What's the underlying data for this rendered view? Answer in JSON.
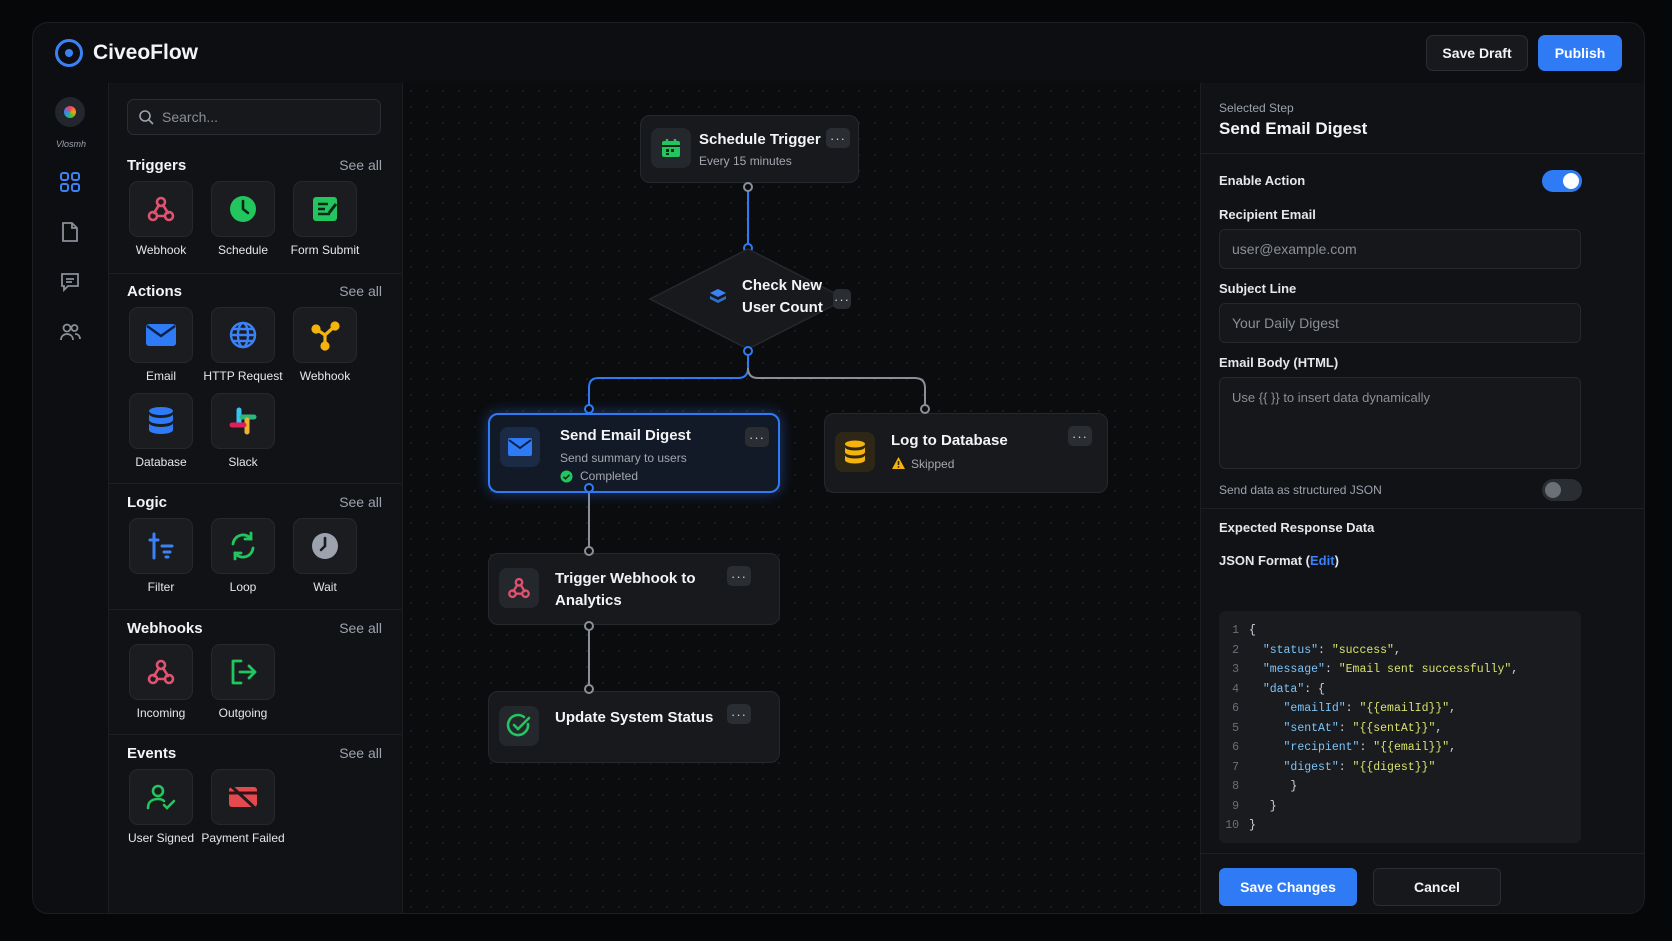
{
  "app": {
    "name": "CiveoFlow",
    "save_draft": "Save Draft",
    "publish": "Publish"
  },
  "rail": {
    "user_caption": "Vlosmh"
  },
  "palette": {
    "search_placeholder": "Search...",
    "see_all": "See all",
    "triggers": {
      "title": "Triggers",
      "items": [
        "Webhook",
        "Schedule",
        "Form Submit"
      ]
    },
    "actions": {
      "title": "Actions",
      "items": [
        "Email",
        "HTTP Request",
        "Webhook",
        "Database",
        "Slack"
      ]
    },
    "logic": {
      "title": "Logic",
      "items": [
        "Filter",
        "Loop",
        "Wait"
      ]
    },
    "webhooks": {
      "title": "Webhooks",
      "items": [
        "Incoming",
        "Outgoing"
      ]
    },
    "events": {
      "title": "Events",
      "items": [
        "User Signed",
        "Payment Failed"
      ]
    }
  },
  "flow": {
    "schedule": {
      "title": "Schedule Trigger",
      "sub": "Every 15 minutes"
    },
    "check": {
      "title_line1": "Check New",
      "title_line2": "User Count"
    },
    "email": {
      "title": "Send Email Digest",
      "sub": "Send summary to users",
      "status": "Completed"
    },
    "log": {
      "title": "Log to Database",
      "status": "Skipped"
    },
    "trigger_webhook": {
      "title_line1": "Trigger Webhook to",
      "title_line2": "Analytics"
    },
    "update": {
      "title": "Update System Status"
    },
    "menu_glyph": "···"
  },
  "panel": {
    "caption": "Selected Step",
    "title": "Send Email Digest",
    "enable_label": "Enable Action",
    "enable_on": true,
    "recipient_label": "Recipient Email",
    "recipient_placeholder": "user@example.com",
    "subject_label": "Subject Line",
    "subject_placeholder": "Your Daily Digest",
    "body_label": "Email Body (HTML)",
    "body_placeholder": "Use {{ }} to insert data dynamically",
    "json_toggle_label": "Send data as structured JSON",
    "json_on": false,
    "expected_label": "Expected Response Data",
    "json_format_label": "JSON Format (",
    "json_edit": "Edit",
    "json_close": ")",
    "code": {
      "line_numbers": [
        "1",
        "2",
        "3",
        "4",
        "6",
        "5",
        "6",
        "7",
        "8",
        "9",
        "10"
      ],
      "l1": "{",
      "l2k": "\"status\"",
      "l2v": "\"success\"",
      "l3k": "\"message\"",
      "l3v": "\"Email sent successfully\"",
      "l4k": "\"data\"",
      "l4v": "{",
      "l5k": "\"emailId\"",
      "l5v": "\"{{emailId}}\"",
      "l6k": "\"sentAt\"",
      "l6v": "\"{{sentAt}}\"",
      "l7k": "\"recipient\"",
      "l7v": "\"{{email}}\"",
      "l8k": "\"digest\"",
      "l8v": "\"{{digest}}\"",
      "l9": "}",
      "l10": "}",
      "l11": "}"
    },
    "save": "Save Changes",
    "cancel": "Cancel"
  },
  "colors": {
    "accent": "#2f7bf5",
    "success": "#22c55e",
    "warning": "#f59e0b",
    "webhook": "#e0526f"
  }
}
